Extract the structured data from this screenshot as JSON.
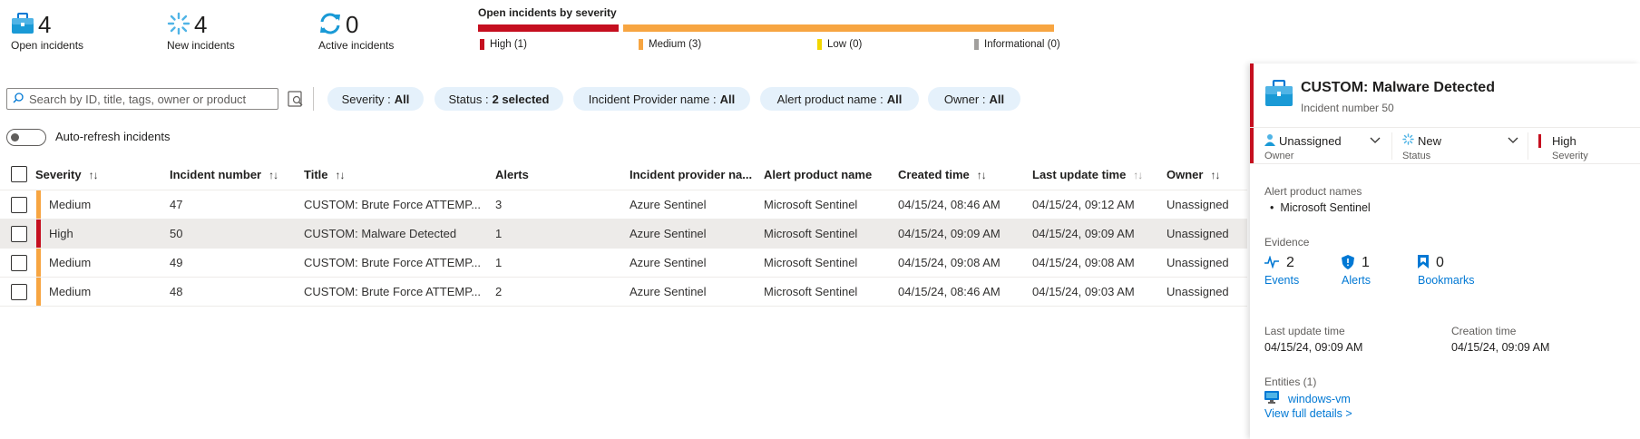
{
  "summary": {
    "open": {
      "count": "4",
      "label": "Open incidents",
      "icon": "briefcase-icon"
    },
    "new": {
      "count": "4",
      "label": "New incidents",
      "icon": "spinner-icon"
    },
    "active": {
      "count": "0",
      "label": "Active incidents",
      "icon": "refresh-icon"
    }
  },
  "severity_chart": {
    "title": "Open incidents by severity",
    "legend": [
      {
        "label": "High (1)",
        "color": "#c50f1f",
        "count": 1
      },
      {
        "label": "Medium (3)",
        "color": "#f7a541",
        "count": 3
      },
      {
        "label": "Low (0)",
        "color": "#f2d600",
        "count": 0
      },
      {
        "label": "Informational (0)",
        "color": "#a19f9d",
        "count": 0
      }
    ]
  },
  "filters": {
    "search_placeholder": "Search by ID, title, tags, owner or product",
    "pills": [
      {
        "key": "Severity :",
        "value": "All"
      },
      {
        "key": "Status :",
        "value": "2 selected"
      },
      {
        "key": "Incident Provider name :",
        "value": "All"
      },
      {
        "key": "Alert product name :",
        "value": "All"
      },
      {
        "key": "Owner :",
        "value": "All"
      }
    ],
    "auto_refresh_label": "Auto-refresh incidents"
  },
  "table": {
    "columns": [
      "Severity",
      "Incident number",
      "Title",
      "Alerts",
      "Incident provider na...",
      "Alert product name",
      "Created time",
      "Last update time",
      "Owner"
    ],
    "rows": [
      {
        "severity": "Medium",
        "sev_color": "#f7a541",
        "number": "47",
        "title": "CUSTOM: Brute Force ATTEMP...",
        "alerts": "3",
        "provider": "Azure Sentinel",
        "product": "Microsoft Sentinel",
        "created": "04/15/24, 08:46 AM",
        "updated": "04/15/24, 09:12 AM",
        "owner": "Unassigned"
      },
      {
        "severity": "High",
        "sev_color": "#c50f1f",
        "number": "50",
        "title": "CUSTOM: Malware Detected",
        "alerts": "1",
        "provider": "Azure Sentinel",
        "product": "Microsoft Sentinel",
        "created": "04/15/24, 09:09 AM",
        "updated": "04/15/24, 09:09 AM",
        "owner": "Unassigned"
      },
      {
        "severity": "Medium",
        "sev_color": "#f7a541",
        "number": "49",
        "title": "CUSTOM: Brute Force ATTEMP...",
        "alerts": "1",
        "provider": "Azure Sentinel",
        "product": "Microsoft Sentinel",
        "created": "04/15/24, 09:08 AM",
        "updated": "04/15/24, 09:08 AM",
        "owner": "Unassigned"
      },
      {
        "severity": "Medium",
        "sev_color": "#f7a541",
        "number": "48",
        "title": "CUSTOM: Brute Force ATTEMP...",
        "alerts": "2",
        "provider": "Azure Sentinel",
        "product": "Microsoft Sentinel",
        "created": "04/15/24, 08:46 AM",
        "updated": "04/15/24, 09:03 AM",
        "owner": "Unassigned"
      }
    ]
  },
  "detail": {
    "title": "CUSTOM: Malware Detected",
    "subtitle": "Incident number 50",
    "owner": {
      "value": "Unassigned",
      "label": "Owner"
    },
    "status": {
      "value": "New",
      "label": "Status"
    },
    "severity": {
      "value": "High",
      "label": "Severity"
    },
    "alert_products_label": "Alert product names",
    "alert_products": [
      "Microsoft Sentinel"
    ],
    "evidence_label": "Evidence",
    "evidence": [
      {
        "count": "2",
        "label": "Events"
      },
      {
        "count": "1",
        "label": "Alerts"
      },
      {
        "count": "0",
        "label": "Bookmarks"
      }
    ],
    "last_update_label": "Last update time",
    "last_update_value": "04/15/24, 09:09 AM",
    "creation_label": "Creation time",
    "creation_value": "04/15/24, 09:09 AM",
    "entities_label": "Entities (1)",
    "entity": "windows-vm",
    "full_details": "View full details >"
  },
  "colors": {
    "accent": "#0078d4",
    "high": "#c50f1f",
    "medium": "#f7a541",
    "pill_bg": "#e5f1fb"
  }
}
